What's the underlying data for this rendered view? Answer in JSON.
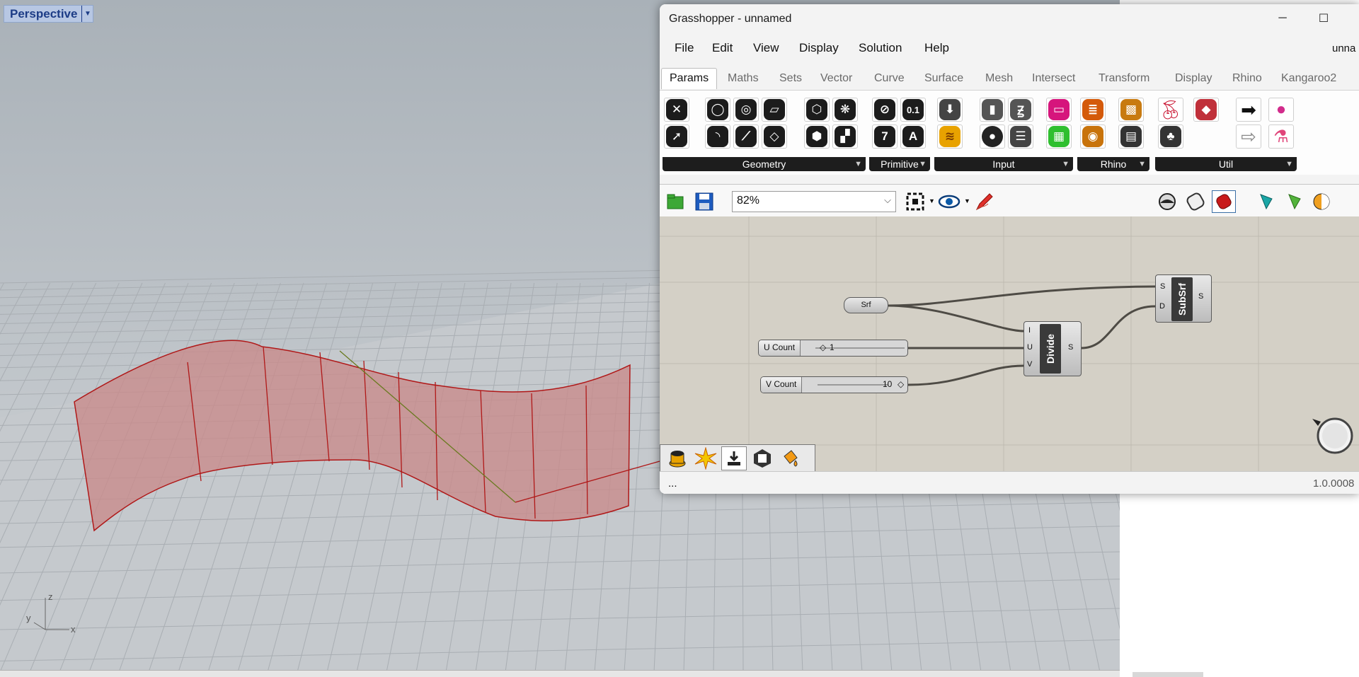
{
  "viewport": {
    "label": "Perspective",
    "axes": {
      "x": "x",
      "y": "y",
      "z": "z"
    }
  },
  "grasshopper": {
    "title": "Grasshopper - unnamed",
    "menu": [
      "File",
      "Edit",
      "View",
      "Display",
      "Solution",
      "Help"
    ],
    "doc_name": "unna",
    "tabs": [
      "Params",
      "Maths",
      "Sets",
      "Vector",
      "Curve",
      "Surface",
      "Mesh",
      "Intersect",
      "Transform",
      "Display",
      "Rhino",
      "Kangaroo2"
    ],
    "active_tab": "Params",
    "ribbon_groups": [
      "Geometry",
      "Primitive",
      "Input",
      "Rhino",
      "Util"
    ],
    "primitive_glyphs": [
      "0.1",
      "7",
      "A"
    ],
    "zoom": "82%",
    "canvas": {
      "srf": {
        "label": "Srf"
      },
      "u_slider": {
        "label": "U Count",
        "value": "1"
      },
      "v_slider": {
        "label": "V Count",
        "value": "10"
      },
      "divide": {
        "title": "Divide",
        "inputs": [
          "I",
          "U",
          "V"
        ],
        "output": "S"
      },
      "subsrf": {
        "title": "SubSrf",
        "inputs": [
          "S",
          "D"
        ],
        "output": "S"
      }
    },
    "status_left": "...",
    "version": "1.0.0008"
  },
  "colors": {
    "surface_fill": "#c98a8a",
    "surface_edge": "#b01818",
    "canvas_bg": "#d4d0c6",
    "viewport_bg": "#c9cdd1"
  }
}
